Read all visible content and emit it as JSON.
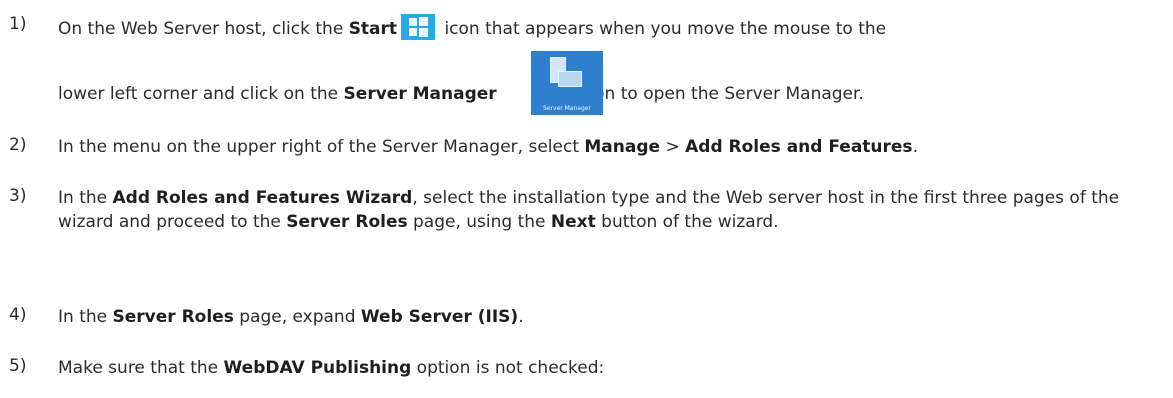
{
  "steps": [
    {
      "number": "1)",
      "line1": {
        "t1": "On the Web Server host, click the ",
        "b1": "Start",
        "t2": " icon that appears when you move the mouse to the"
      },
      "line2": {
        "t1": "lower left corner and click on the ",
        "b1": "Server Manager",
        "t2": " icon to open the Server Manager."
      },
      "start_icon": "windows-logo-icon",
      "server_manager_icon": "server-manager-icon",
      "server_manager_icon_caption": "Server Manager"
    },
    {
      "number": "2)",
      "t1": "In the menu on the upper right of the Server Manager, select ",
      "b1": "Manage",
      "t2": " > ",
      "b2": "Add Roles and Features",
      "t3": "."
    },
    {
      "number": "3)",
      "t1": "In the ",
      "b1": "Add Roles and Features Wizard",
      "t2": ", select the installation type and the Web server host in the first three pages of the wizard and proceed to the ",
      "b2": "Server Roles",
      "t3": " page, using the ",
      "b3": "Next",
      "t4": " button of the wizard."
    },
    {
      "number": "4)",
      "t1": "In the ",
      "b1": "Server Roles",
      "t2": " page, expand ",
      "b2": "Web Server (IIS)",
      "t3": "."
    },
    {
      "number": "5)",
      "t1": "Make sure that the ",
      "b1": "WebDAV Publishing",
      "t2": " option is not checked:"
    }
  ]
}
